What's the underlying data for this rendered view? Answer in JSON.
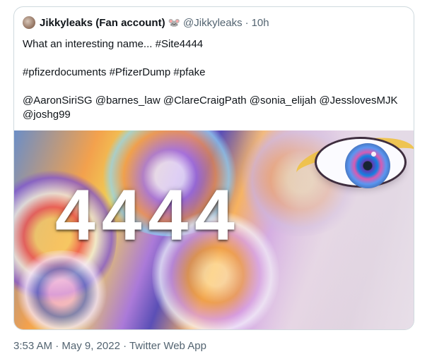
{
  "tweet": {
    "display_name": "Jikkyleaks (Fan account)",
    "emoji": "🐭",
    "handle": "@Jikkyleaks",
    "separator": "·",
    "age": "10h",
    "lines": [
      "What an interesting name... #Site4444",
      "",
      "#pfizerdocuments  #PfizerDump #pfake",
      "",
      "@AaronSiriSG @barnes_law @ClareCraigPath @sonia_elijah @JesslovesMJK",
      "@joshg99"
    ]
  },
  "media": {
    "number_text": "4444"
  },
  "footer": {
    "timestamp": "3:53 AM · May 9, 2022 · Twitter Web App"
  }
}
